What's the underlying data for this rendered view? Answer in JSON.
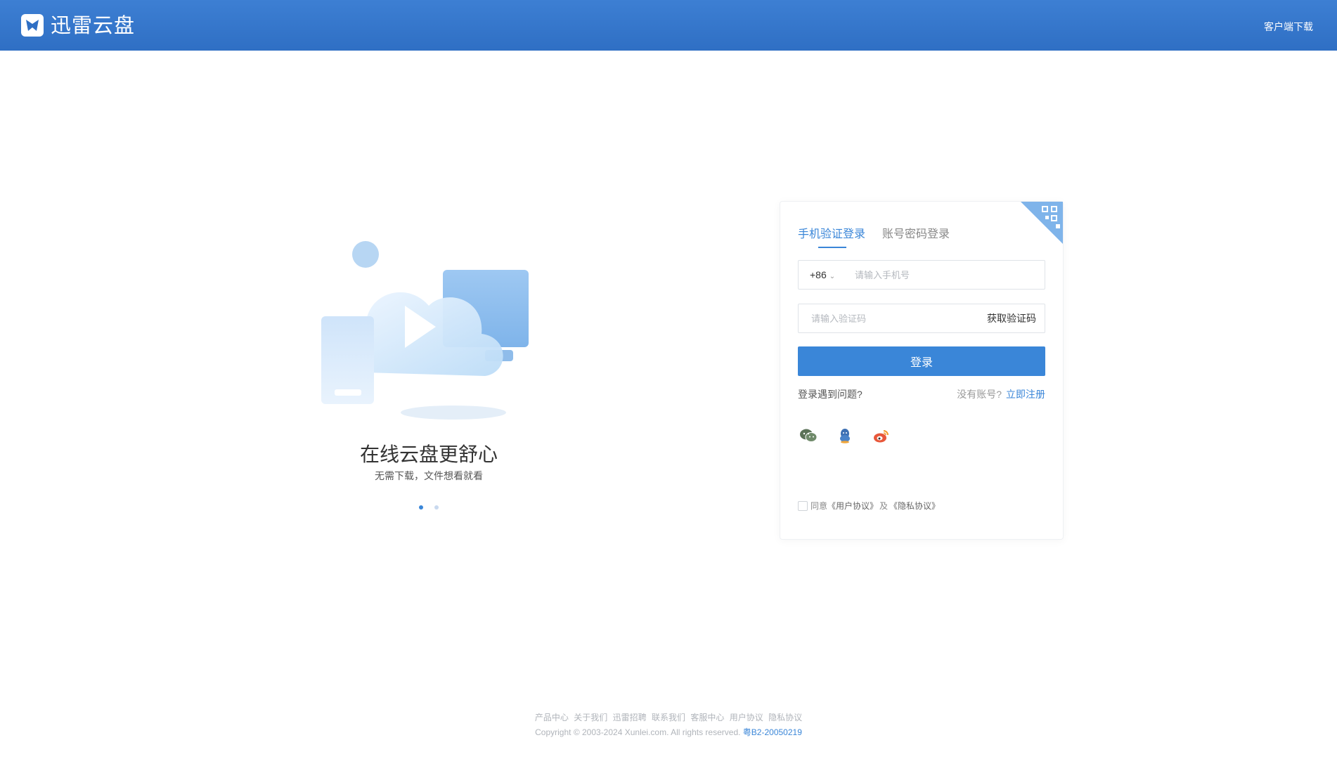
{
  "header": {
    "brand_name": "迅雷云盘",
    "client_download": "客户端下载"
  },
  "promo": {
    "title": "在线云盘更舒心",
    "subtitle": "无需下载，文件想看就看",
    "carousel_count": 2,
    "carousel_active": 1
  },
  "login": {
    "tabs": [
      {
        "label": "手机验证登录",
        "active": true
      },
      {
        "label": "账号密码登录",
        "active": false
      }
    ],
    "country_code": "+86",
    "phone_placeholder": "请输入手机号",
    "code_placeholder": "请输入验证码",
    "get_code": "获取验证码",
    "submit": "登录",
    "trouble": "登录遇到问题?",
    "no_account": "没有账号?",
    "register": "立即注册",
    "social_icons": [
      "wechat-icon",
      "qq-icon",
      "weibo-icon"
    ],
    "agree_text": "同意",
    "user_agreement": "《用户协议》",
    "and_text": "及",
    "privacy_agreement": "《隐私协议》"
  },
  "footer": {
    "links": [
      "产品中心",
      "关于我们",
      "迅雷招聘",
      "联系我们",
      "客服中心",
      "用户协议",
      "隐私协议"
    ],
    "copyright": "Copyright © 2003-2024 Xunlei.com. All rights reserved.",
    "icp": "粤B2-20050219"
  },
  "colors": {
    "header_bg": "#2f6fc4",
    "accent": "#3a86d8"
  }
}
